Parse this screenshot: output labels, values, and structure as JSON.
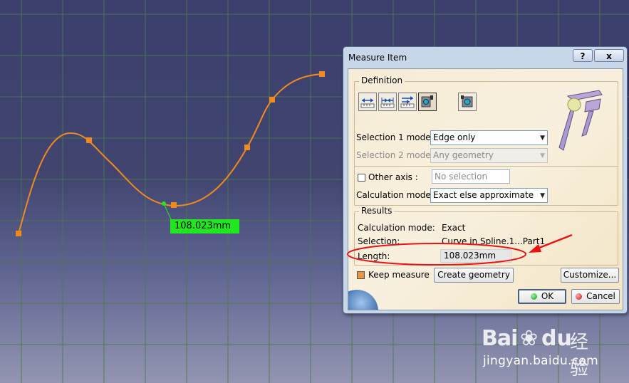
{
  "viewport": {
    "measure_label": "108.023mm"
  },
  "dialog": {
    "title": "Measure Item",
    "help_label": "?",
    "close_label": "x",
    "definition": {
      "group_label": "Definition",
      "tools": [
        "measure-between-icon",
        "measure-between-chain-icon",
        "measure-between-fan-icon",
        "measure-item-icon",
        "measure-thickness-icon"
      ],
      "selection1_label": "Selection 1 mode:",
      "selection1_value": "Edge only",
      "selection2_label": "Selection 2 mode:",
      "selection2_value": "Any geometry",
      "other_axis_label": "Other axis :",
      "other_axis_value": "No selection",
      "calc_mode_label": "Calculation mode:",
      "calc_mode_value": "Exact else approximate"
    },
    "results": {
      "group_label": "Results",
      "calc_mode_label": "Calculation mode:",
      "calc_mode_value": "Exact",
      "selection_label": "Selection:",
      "selection_value": "Curve in Spline.1...Part1",
      "length_label": "Length:",
      "length_value": "108.023mm"
    },
    "keep_measure_label": "Keep measure",
    "keep_measure_checked": true,
    "create_geometry_label": "Create geometry",
    "customize_label": "Customize...",
    "ok_label": "OK",
    "cancel_label": "Cancel"
  },
  "watermark": {
    "brand": "Bai",
    "brand2": "du",
    "cn": "经验",
    "url": "jingyan.baidu.com"
  },
  "colors": {
    "spline": "#f08a1e",
    "highlight_ring": "#ee1111",
    "measure_label_bg": "#1fe81f"
  }
}
